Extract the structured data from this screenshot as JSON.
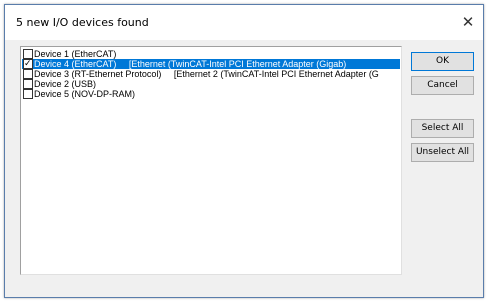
{
  "dialog": {
    "title": "5 new I/O devices found",
    "close_glyph": "✕"
  },
  "devices": [
    {
      "label": "Device 1 (EtherCAT)",
      "checked": false,
      "selected": false
    },
    {
      "label": "Device 4 (EtherCAT)     [Ethernet (TwinCAT-Intel PCI Ethernet Adapter (Gigab)",
      "checked": true,
      "selected": true
    },
    {
      "label": "Device 3 (RT-Ethernet Protocol)     [Ethernet 2 (TwinCAT-Intel PCI Ethernet Adapter (G",
      "checked": false,
      "selected": false
    },
    {
      "label": "Device 2 (USB)",
      "checked": false,
      "selected": false
    },
    {
      "label": "Device 5 (NOV-DP-RAM)",
      "checked": false,
      "selected": false
    }
  ],
  "buttons": {
    "ok": "OK",
    "cancel": "Cancel",
    "select_all": "Select All",
    "unselect_all": "Unselect All"
  },
  "colors": {
    "selection": "#0078d7",
    "dialog_bg": "#f0f0f0"
  }
}
